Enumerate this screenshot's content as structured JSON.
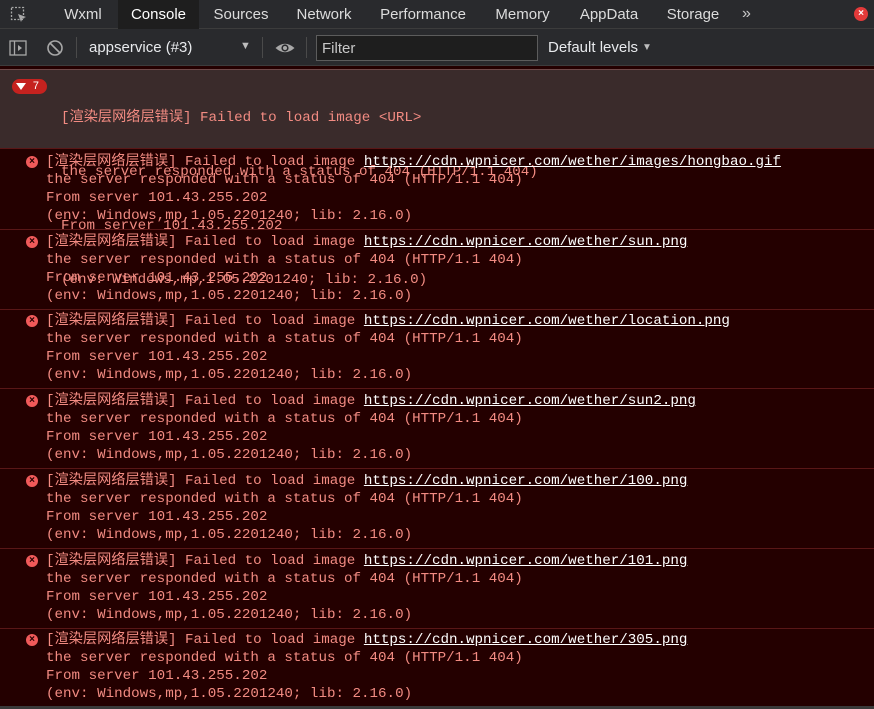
{
  "tabs": [
    "Wxml",
    "Console",
    "Sources",
    "Network",
    "Performance",
    "Memory",
    "AppData",
    "Storage"
  ],
  "active_tab": "Console",
  "more_tabs_glyph": "»",
  "close_glyph": "×",
  "icons": {
    "inspect": "element-picker-icon",
    "sidebar": "show-sidebar-icon",
    "clear": "clear-console-icon",
    "eye": "live-expression-eye-icon",
    "error": "error-x-icon",
    "close": "close-devtools-icon"
  },
  "toolbar": {
    "context": "appservice (#3)",
    "filter_placeholder": "Filter",
    "levels_label": "Default levels"
  },
  "colors": {
    "error_text": "#f28b82",
    "error_bg": "#240000",
    "badge": "#c5221f",
    "link": "#ffffff"
  },
  "group": {
    "count": "7",
    "line1": "[渲染层网络层错误] Failed to load image <URL>",
    "line2": "the server responded with a status of 404 (HTTP/1.1 404)",
    "line3": "From server 101.43.255.202",
    "line4": "(env: Windows,mp,1.05.2201240; lib: 2.16.0)"
  },
  "messages": [
    {
      "prefix": "[渲染层网络层错误] Failed to load image ",
      "url": "https://cdn.wpnicer.com/wether/images/hongbao.gif",
      "line2": "the server responded with a status of 404 (HTTP/1.1 404)",
      "line3": "From server 101.43.255.202",
      "line4": "(env: Windows,mp,1.05.2201240; lib: 2.16.0)"
    },
    {
      "prefix": "[渲染层网络层错误] Failed to load image ",
      "url": "https://cdn.wpnicer.com/wether/sun.png",
      "line2": "the server responded with a status of 404 (HTTP/1.1 404)",
      "line3": "From server 101.43.255.202",
      "line4": "(env: Windows,mp,1.05.2201240; lib: 2.16.0)"
    },
    {
      "prefix": "[渲染层网络层错误] Failed to load image ",
      "url": "https://cdn.wpnicer.com/wether/location.png",
      "line2": "the server responded with a status of 404 (HTTP/1.1 404)",
      "line3": "From server 101.43.255.202",
      "line4": "(env: Windows,mp,1.05.2201240; lib: 2.16.0)"
    },
    {
      "prefix": "[渲染层网络层错误] Failed to load image ",
      "url": "https://cdn.wpnicer.com/wether/sun2.png",
      "line2": "the server responded with a status of 404 (HTTP/1.1 404)",
      "line3": "From server 101.43.255.202",
      "line4": "(env: Windows,mp,1.05.2201240; lib: 2.16.0)"
    },
    {
      "prefix": "[渲染层网络层错误] Failed to load image ",
      "url": "https://cdn.wpnicer.com/wether/100.png",
      "line2": "the server responded with a status of 404 (HTTP/1.1 404)",
      "line3": "From server 101.43.255.202",
      "line4": "(env: Windows,mp,1.05.2201240; lib: 2.16.0)"
    },
    {
      "prefix": "[渲染层网络层错误] Failed to load image ",
      "url": "https://cdn.wpnicer.com/wether/101.png",
      "line2": "the server responded with a status of 404 (HTTP/1.1 404)",
      "line3": "From server 101.43.255.202",
      "line4": "(env: Windows,mp,1.05.2201240; lib: 2.16.0)"
    },
    {
      "prefix": "[渲染层网络层错误] Failed to load image ",
      "url": "https://cdn.wpnicer.com/wether/305.png",
      "line2": "the server responded with a status of 404 (HTTP/1.1 404)",
      "line3": "From server 101.43.255.202",
      "line4": "(env: Windows,mp,1.05.2201240; lib: 2.16.0)"
    }
  ]
}
